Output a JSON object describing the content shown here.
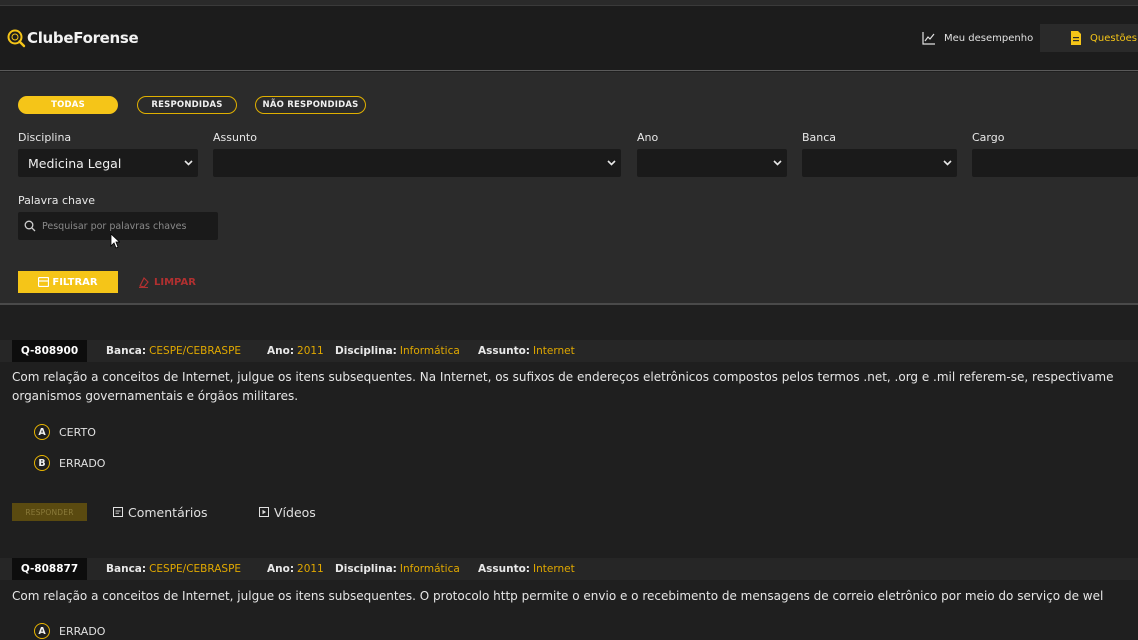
{
  "header": {
    "logo_text": "ClubeForense",
    "nav_performance": "Meu desempenho",
    "nav_questions": "Questões"
  },
  "filters": {
    "tabs": [
      "TODAS",
      "RESPONDIDAS",
      "NÃO RESPONDIDAS"
    ],
    "active_tab": "TODAS",
    "labels": {
      "disciplina": "Disciplina",
      "assunto": "Assunto",
      "ano": "Ano",
      "banca": "Banca",
      "cargo": "Cargo",
      "palavra_chave": "Palavra chave"
    },
    "disciplina_value": "Medicina Legal",
    "search_placeholder": "Pesquisar por palavras chaves",
    "filter_button": "FILTRAR",
    "clear_button": "LIMPAR"
  },
  "questions": [
    {
      "id": "Q-808900",
      "banca_label": "Banca:",
      "banca": "CESPE/CEBRASPE",
      "ano_label": "Ano:",
      "ano": "2011",
      "disciplina_label": "Disciplina:",
      "disciplina": "Informática",
      "assunto_label": "Assunto:",
      "assunto": "Internet",
      "text_line1": "Com relação a conceitos de Internet, julgue os itens subsequentes. Na Internet, os sufixos de endereços eletrônicos compostos pelos termos .net, .org e .mil referem-se, respectivame",
      "text_line2": "organismos governamentais e órgãos militares.",
      "options": [
        {
          "letter": "A",
          "label": "CERTO"
        },
        {
          "letter": "B",
          "label": "ERRADO"
        }
      ],
      "respond_button": "RESPONDER",
      "comments_link": "Comentários",
      "videos_link": "Vídeos"
    },
    {
      "id": "Q-808877",
      "banca_label": "Banca:",
      "banca": "CESPE/CEBRASPE",
      "ano_label": "Ano:",
      "ano": "2011",
      "disciplina_label": "Disciplina:",
      "disciplina": "Informática",
      "assunto_label": "Assunto:",
      "assunto": "Internet",
      "text_line1": "Com relação a conceitos de Internet, julgue os itens subsequentes. O protocolo http permite o envio e o recebimento de mensagens de correio eletrônico por meio do serviço de wel",
      "options": [
        {
          "letter": "A",
          "label": "ERRADO"
        }
      ]
    }
  ],
  "colors": {
    "accent": "#f5c518",
    "danger": "#b03030",
    "background": "#1f1f1f",
    "panel": "#2b2b2b"
  }
}
